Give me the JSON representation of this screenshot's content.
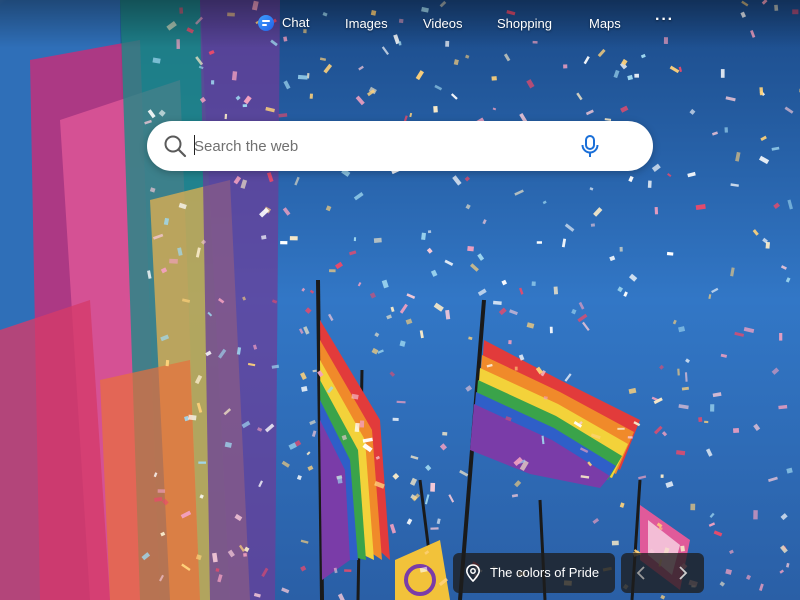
{
  "nav": {
    "chat_label": "Chat",
    "images_label": "Images",
    "videos_label": "Videos",
    "shopping_label": "Shopping",
    "maps_label": "Maps",
    "more_label": "···"
  },
  "search": {
    "placeholder": "Search the web",
    "value": ""
  },
  "caption": {
    "text": "The colors of Pride"
  },
  "icons": {
    "chat": "chat-icon",
    "search": "search-icon",
    "mic": "microphone-icon",
    "location": "location-pin-icon",
    "prev": "chevron-left-icon",
    "next": "chevron-right-icon"
  },
  "colors": {
    "accent_blue": "#1a6fd8",
    "sky_blue": "#3b7bc8",
    "pill_bg": "#1e1e1e"
  }
}
